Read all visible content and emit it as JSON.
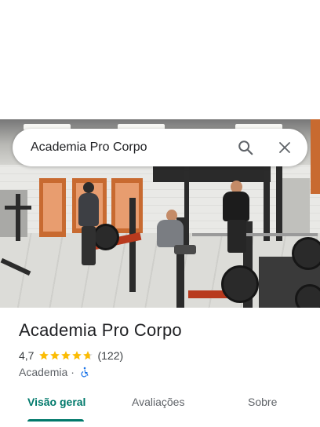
{
  "search": {
    "query": "Academia Pro Corpo",
    "search_icon": "search-icon",
    "close_icon": "close-icon"
  },
  "place": {
    "title": "Academia Pro Corpo",
    "rating": "4,7",
    "rating_value": 4.7,
    "rating_max": 5,
    "reviews_count": "(122)",
    "category": "Academia",
    "separator": "·",
    "accessibility_icon": "wheelchair-icon"
  },
  "tabs": [
    {
      "label": "Visão geral",
      "active": true
    },
    {
      "label": "Avaliações",
      "active": false
    },
    {
      "label": "Sobre",
      "active": false
    }
  ],
  "colors": {
    "accent": "#00796b",
    "star": "#fbbc04",
    "accessibility": "#1a73e8"
  }
}
